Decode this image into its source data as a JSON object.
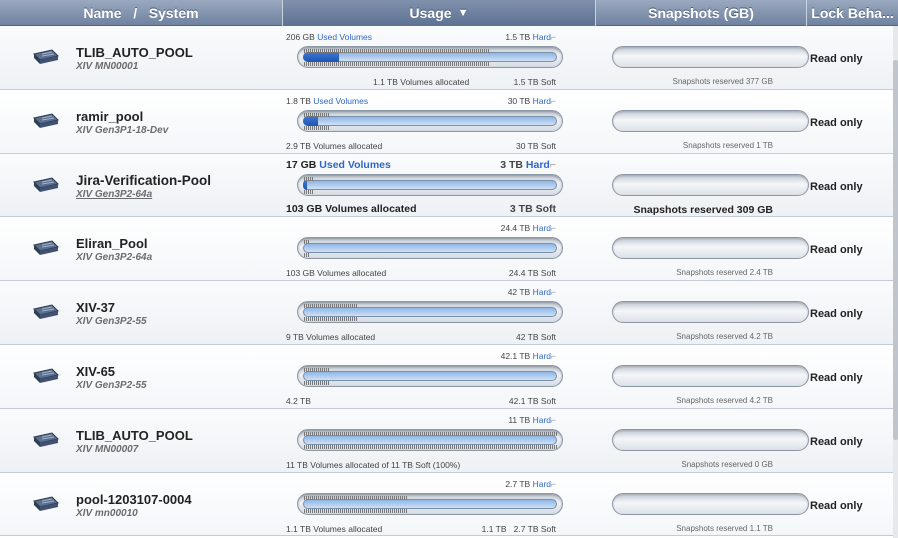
{
  "header": {
    "name_label": "Name   /   System",
    "usage_label": "Usage",
    "snapshots_label": "Snapshots (GB)",
    "lock_label": "Lock Beha..."
  },
  "pools": [
    {
      "name": "TLIB_AUTO_POOL",
      "system": "XIV MN00001",
      "used_label": "206 GB",
      "used_suffix": "Used Volumes",
      "hard": "1.5 TB",
      "hard_suffix": "Hard",
      "allocated": "1.1 TB Volumes allocated",
      "soft": "1.5 TB Soft",
      "snapshots": "Snapshots reserved 377 GB",
      "lock": "Read only",
      "used_fraction": 0.14,
      "alloc_fraction": 0.73
    },
    {
      "name": "ramir_pool",
      "system": "XIV Gen3P1-18-Dev",
      "used_label": "1.8 TB",
      "used_suffix": "Used Volumes",
      "hard": "30 TB",
      "hard_suffix": "Hard",
      "allocated": "2.9 TB Volumes allocated",
      "soft": "30 TB Soft",
      "snapshots": "Snapshots reserved 1 TB",
      "lock": "Read only",
      "used_fraction": 0.06,
      "alloc_fraction": 0.1
    },
    {
      "name": "Jira-Verification-Pool",
      "system": "XIV Gen3P2-64a",
      "used_label": "17 GB",
      "used_suffix": "Used Volumes",
      "hard": "3 TB",
      "hard_suffix": "Hard",
      "allocated": "103 GB Volumes allocated",
      "soft": "3 TB Soft",
      "snapshots": "Snapshots reserved 309 GB",
      "lock": "Read only",
      "used_fraction": 0.01,
      "alloc_fraction": 0.04
    },
    {
      "name": "Eliran_Pool",
      "system": "XIV Gen3P2-64a",
      "used_label": "",
      "used_suffix": "",
      "hard": "24.4 TB",
      "hard_suffix": "Hard",
      "allocated": "103 GB Volumes allocated",
      "soft": "24.4 TB Soft",
      "snapshots": "Snapshots reserved 2.4 TB",
      "lock": "Read only",
      "used_fraction": 0,
      "alloc_fraction": 0.01
    },
    {
      "name": "XIV-37",
      "system": "XIV Gen3P2-55",
      "used_label": "",
      "used_suffix": "",
      "hard": "42 TB",
      "hard_suffix": "Hard",
      "allocated": "9 TB Volumes allocated",
      "soft": "42 TB Soft",
      "snapshots": "Snapshots reserved 4.2 TB",
      "lock": "Read only",
      "used_fraction": 0,
      "alloc_fraction": 0.21
    },
    {
      "name": "XIV-65",
      "system": "XIV Gen3P2-55",
      "used_label": "",
      "used_suffix": "",
      "hard": "42.1 TB",
      "hard_suffix": "Hard",
      "allocated": "4.2 TB",
      "soft": "42.1 TB Soft",
      "snapshots": "Snapshots reserved 4.2 TB",
      "lock": "Read only",
      "used_fraction": 0,
      "alloc_fraction": 0.1
    },
    {
      "name": "TLIB_AUTO_POOL",
      "system": "XIV MN00007",
      "used_label": "",
      "used_suffix": "",
      "hard": "11 TB",
      "hard_suffix": "Hard",
      "allocated": "11 TB Volumes allocated of 11 TB Soft (100%)",
      "soft": "",
      "snapshots": "Snapshots reserved 0 GB",
      "lock": "Read only",
      "used_fraction": 0,
      "alloc_fraction": 1.0
    },
    {
      "name": "pool-1203107-0004",
      "system": "XIV mn00010",
      "used_label": "",
      "used_suffix": "",
      "hard": "2.7 TB",
      "hard_suffix": "Hard",
      "allocated": "1.1 TB Volumes allocated",
      "soft": "1.1 TB   2.7 TB Soft",
      "snapshots": "Snapshots reserved 1.1 TB",
      "lock": "Read only",
      "used_fraction": 0,
      "alloc_fraction": 0.41
    }
  ]
}
